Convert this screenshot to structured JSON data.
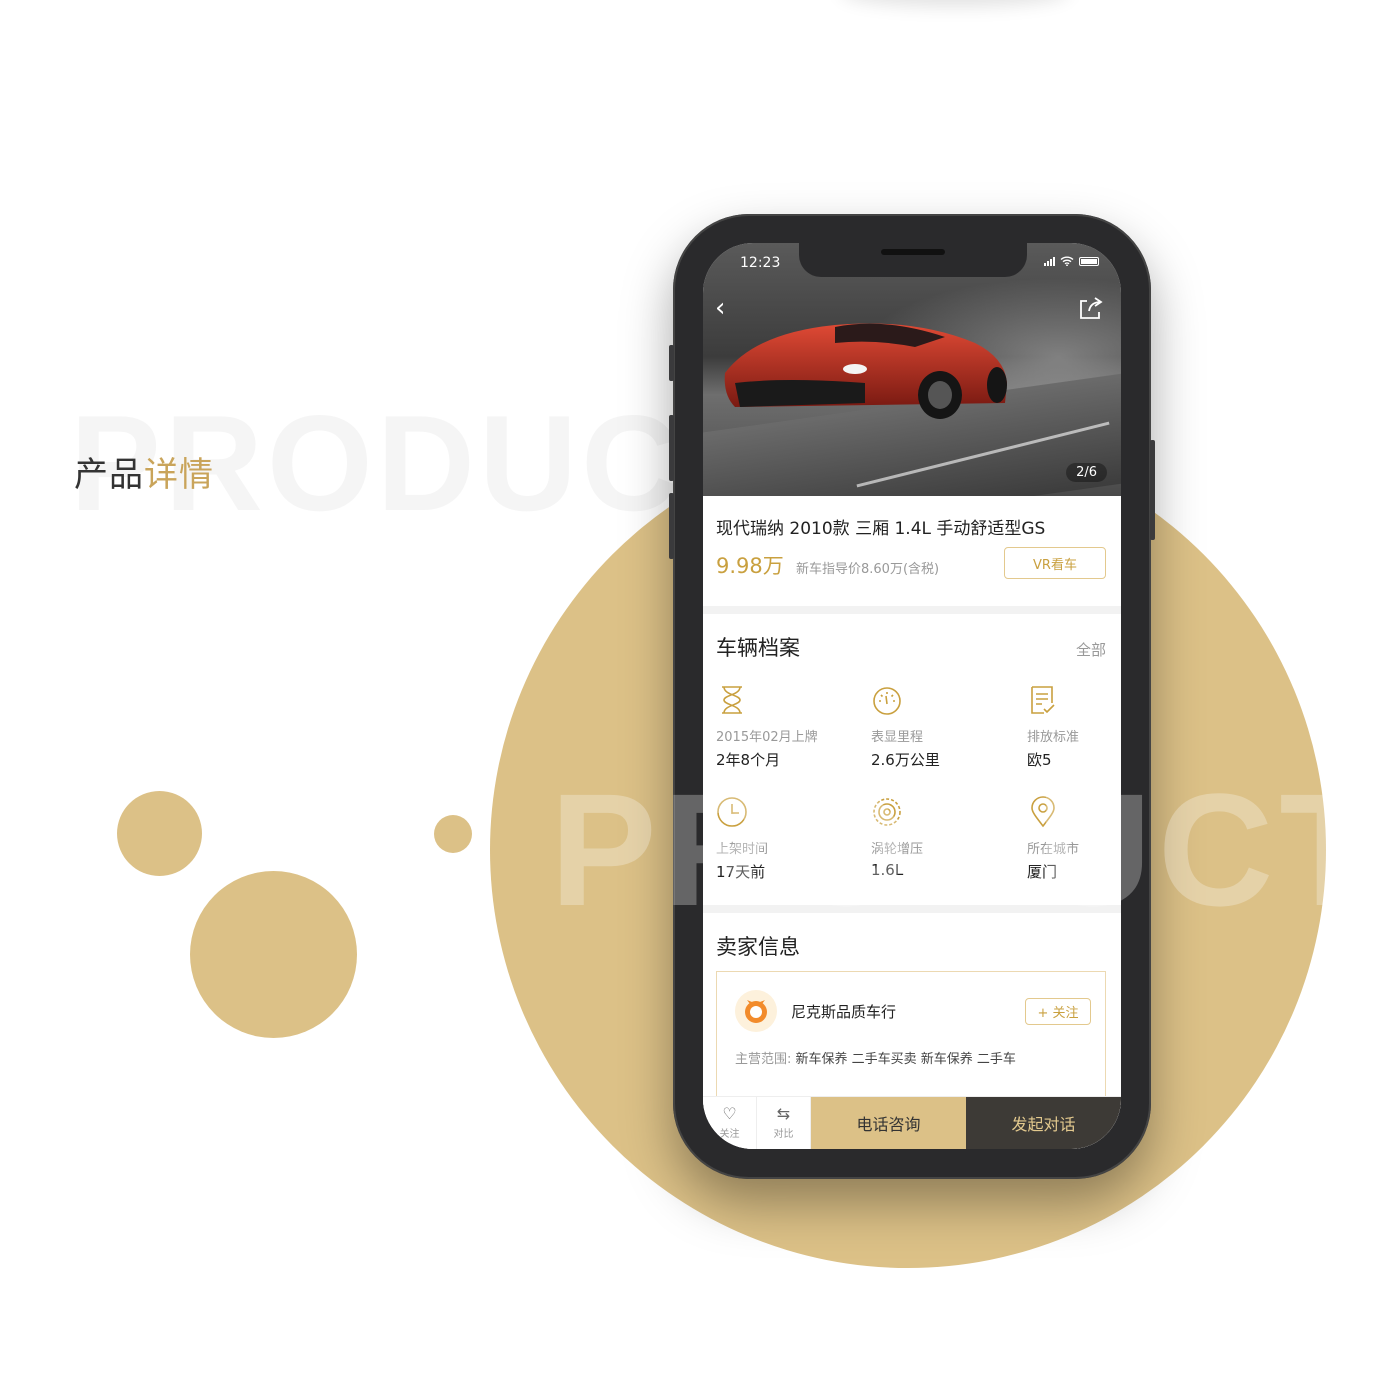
{
  "page": {
    "watermark_top": "PRODUCT",
    "watermark_circle": "PRODUCT",
    "heading_prefix": "产品",
    "heading_accent": "详情"
  },
  "status_bar": {
    "time": "12:23"
  },
  "gallery": {
    "counter": "2/6"
  },
  "listing": {
    "title": "现代瑞纳 2010款 三厢 1.4L 手动舒适型GS",
    "price": "9.98万",
    "guide_price": "新车指导价8.60万(含税)",
    "vr_button": "VR看车"
  },
  "archive": {
    "title": "车辆档案",
    "see_all": "全部",
    "specs": [
      {
        "label": "2015年02月上牌",
        "value": "2年8个月",
        "icon": "hourglass-icon"
      },
      {
        "label": "表显里程",
        "value": "2.6万公里",
        "icon": "speedometer-icon"
      },
      {
        "label": "排放标准",
        "value": "欧5",
        "icon": "document-check-icon"
      },
      {
        "label": "上架时间",
        "value": "17天前",
        "icon": "clock-icon"
      },
      {
        "label": "涡轮增压",
        "value": "1.6L",
        "icon": "turbo-gear-icon"
      },
      {
        "label": "所在城市",
        "value": "厦门",
        "icon": "location-pin-icon"
      }
    ]
  },
  "seller": {
    "title": "卖家信息",
    "shop_name": "尼克斯品质车行",
    "follow_button": "+ 关注",
    "scope_label": "主营范围:",
    "scope_value": "新车保养 二手车买卖 新车保养 二手车"
  },
  "bottom_bar": {
    "favorite_label": "关注",
    "compare_label": "对比",
    "call_button": "电话咨询",
    "chat_button": "发起对话"
  },
  "colors": {
    "accent": "#dcc187",
    "accent_text": "#c9a03f",
    "dark": "#3d3a36"
  }
}
